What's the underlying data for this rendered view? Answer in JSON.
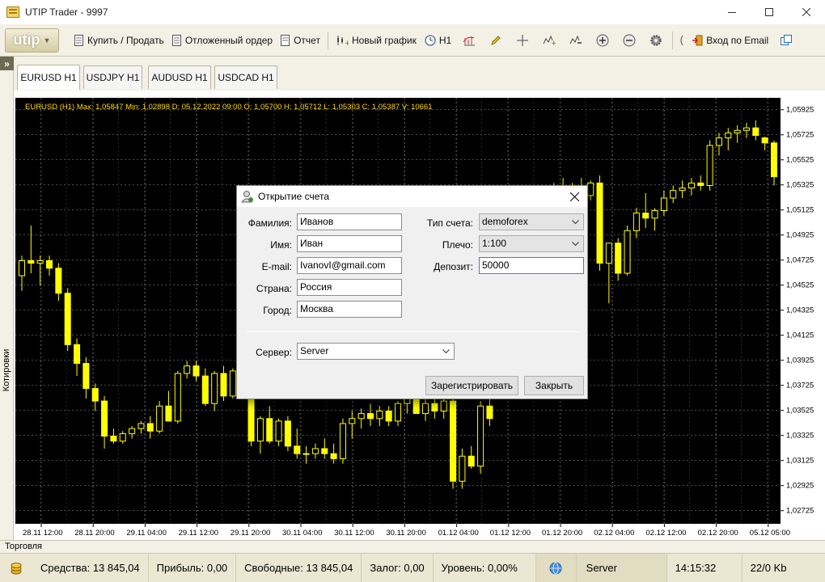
{
  "window": {
    "title": "UTIP Trader - 9997"
  },
  "toolbar": {
    "logo": "utip",
    "buy_sell": "Купить / Продать",
    "pending_order": "Отложенный ордер",
    "report": "Отчет",
    "new_chart": "Новый график",
    "timeframe": "H1",
    "login_email": "Вход по Email"
  },
  "side_panel": {
    "label": "Котировки"
  },
  "tabs": [
    {
      "label": "EURUSD  H1"
    },
    {
      "label": "USDJPY  H1"
    },
    {
      "label": "AUDUSD  H1"
    },
    {
      "label": "USDCAD  H1"
    }
  ],
  "chart_info": "EURUSD (H1)  Max: 1,05847  Min: 1,02898  D: 05.12.2022 09:00  O: 1,05700  H: 1,05712  L: 1,05303  C: 1,05387  V: 10661",
  "chart_data": {
    "type": "candlestick",
    "symbol": "EURUSD",
    "timeframe": "H1",
    "ylim": [
      1.0262,
      1.0602
    ],
    "grid": true,
    "background": "#000000",
    "candle_color": "#ffff00",
    "y_ticks": [
      "1,05925",
      "1,05725",
      "1,05525",
      "1,05325",
      "1,05125",
      "1,04925",
      "1,04725",
      "1,04525",
      "1,04325",
      "1,04125",
      "1,03925",
      "1,03725",
      "1,03525",
      "1,03325",
      "1,03125",
      "1,02925",
      "1,02725"
    ],
    "x_ticks": [
      "28.11 12:00",
      "28.11 20:00",
      "29.11 04:00",
      "29.11 12:00",
      "29.11 20:00",
      "30.11 04:00",
      "30.11 12:00",
      "30.11 20:00",
      "01.12 04:00",
      "01.12 12:00",
      "01.12 20:00",
      "02.12 04:00",
      "02.12 12:00",
      "02.12 20:00",
      "05.12 05:00"
    ],
    "candles": [
      [
        1.046,
        1.0476,
        1.0448,
        1.0472
      ],
      [
        1.0472,
        1.05,
        1.0462,
        1.047
      ],
      [
        1.047,
        1.0476,
        1.0452,
        1.0472
      ],
      [
        1.0472,
        1.0476,
        1.046,
        1.0466
      ],
      [
        1.0466,
        1.047,
        1.044,
        1.0446
      ],
      [
        1.0446,
        1.045,
        1.04,
        1.0405
      ],
      [
        1.0405,
        1.041,
        1.038,
        1.039
      ],
      [
        1.039,
        1.0395,
        1.0362,
        1.037
      ],
      [
        1.037,
        1.0374,
        1.0352,
        1.036
      ],
      [
        1.036,
        1.0364,
        1.0322,
        1.0332
      ],
      [
        1.0332,
        1.0338,
        1.0326,
        1.0328
      ],
      [
        1.0328,
        1.0336,
        1.0326,
        1.0334
      ],
      [
        1.0334,
        1.034,
        1.033,
        1.0338
      ],
      [
        1.0338,
        1.0344,
        1.0334,
        1.0342
      ],
      [
        1.0342,
        1.0348,
        1.033,
        1.0336
      ],
      [
        1.0336,
        1.036,
        1.0334,
        1.0356
      ],
      [
        1.0356,
        1.0368,
        1.0346,
        1.0344
      ],
      [
        1.0344,
        1.0384,
        1.0342,
        1.0382
      ],
      [
        1.0382,
        1.0392,
        1.0378,
        1.0388
      ],
      [
        1.0388,
        1.0392,
        1.0376,
        1.038
      ],
      [
        1.038,
        1.0386,
        1.0356,
        1.0358
      ],
      [
        1.0358,
        1.0384,
        1.0352,
        1.0382
      ],
      [
        1.0382,
        1.0388,
        1.036,
        1.0364
      ],
      [
        1.0364,
        1.0386,
        1.0362,
        1.0384
      ],
      [
        1.0384,
        1.0388,
        1.0364,
        1.0368
      ],
      [
        1.0368,
        1.0372,
        1.0324,
        1.0328
      ],
      [
        1.0328,
        1.0348,
        1.0318,
        1.0346
      ],
      [
        1.0346,
        1.0356,
        1.0326,
        1.0328
      ],
      [
        1.0328,
        1.0346,
        1.0324,
        1.0344
      ],
      [
        1.0344,
        1.0348,
        1.032,
        1.0324
      ],
      [
        1.0324,
        1.0338,
        1.0314,
        1.0318
      ],
      [
        1.0318,
        1.0324,
        1.031,
        1.0318
      ],
      [
        1.0318,
        1.0326,
        1.0314,
        1.0322
      ],
      [
        1.0322,
        1.033,
        1.0314,
        1.0318
      ],
      [
        1.0318,
        1.0326,
        1.031,
        1.0314
      ],
      [
        1.0314,
        1.0346,
        1.031,
        1.0342
      ],
      [
        1.0342,
        1.0352,
        1.033,
        1.0346
      ],
      [
        1.0346,
        1.0354,
        1.0338,
        1.035
      ],
      [
        1.035,
        1.0358,
        1.034,
        1.0346
      ],
      [
        1.0346,
        1.0356,
        1.034,
        1.0352
      ],
      [
        1.0352,
        1.0356,
        1.034,
        1.0344
      ],
      [
        1.0344,
        1.036,
        1.034,
        1.0358
      ],
      [
        1.0358,
        1.037,
        1.035,
        1.0362
      ],
      [
        1.0362,
        1.0374,
        1.0354,
        1.035
      ],
      [
        1.035,
        1.0362,
        1.0344,
        1.0358
      ],
      [
        1.0358,
        1.0366,
        1.0346,
        1.0352
      ],
      [
        1.0352,
        1.0364,
        1.0346,
        1.036
      ],
      [
        1.036,
        1.0364,
        1.029,
        1.0296
      ],
      [
        1.0296,
        1.0322,
        1.029,
        1.0316
      ],
      [
        1.0316,
        1.0324,
        1.0306,
        1.0308
      ],
      [
        1.0308,
        1.036,
        1.0302,
        1.0356
      ],
      [
        1.0356,
        1.0362,
        1.034,
        1.0346
      ],
      [
        1.05,
        1.0508,
        1.0494,
        1.0506
      ],
      [
        1.0506,
        1.0516,
        1.0502,
        1.0514
      ],
      [
        1.0514,
        1.052,
        1.0506,
        1.0516
      ],
      [
        1.0516,
        1.0522,
        1.051,
        1.0512
      ],
      [
        1.0512,
        1.053,
        1.051,
        1.0526
      ],
      [
        1.0526,
        1.0532,
        1.0516,
        1.052
      ],
      [
        1.052,
        1.0534,
        1.0516,
        1.053
      ],
      [
        1.053,
        1.0538,
        1.0522,
        1.0526
      ],
      [
        1.0526,
        1.0534,
        1.052,
        1.0532
      ],
      [
        1.0532,
        1.0538,
        1.0522,
        1.0524
      ],
      [
        1.0524,
        1.0536,
        1.052,
        1.0534
      ],
      [
        1.0534,
        1.054,
        1.0464,
        1.047
      ],
      [
        1.047,
        1.0476,
        1.0438,
        1.0486
      ],
      [
        1.0486,
        1.049,
        1.0456,
        1.0462
      ],
      [
        1.0462,
        1.05,
        1.046,
        1.0496
      ],
      [
        1.0496,
        1.0514,
        1.049,
        1.051
      ],
      [
        1.051,
        1.0526,
        1.0498,
        1.0506
      ],
      [
        1.0506,
        1.0514,
        1.0496,
        1.0512
      ],
      [
        1.0512,
        1.0528,
        1.0508,
        1.0522
      ],
      [
        1.0522,
        1.0532,
        1.0518,
        1.0528
      ],
      [
        1.0528,
        1.0536,
        1.0522,
        1.053
      ],
      [
        1.053,
        1.0538,
        1.0524,
        1.0534
      ],
      [
        1.0534,
        1.054,
        1.0528,
        1.0532
      ],
      [
        1.0532,
        1.0568,
        1.0528,
        1.0564
      ],
      [
        1.0564,
        1.0574,
        1.0556,
        1.057
      ],
      [
        1.057,
        1.0578,
        1.056,
        1.0574
      ],
      [
        1.0574,
        1.058,
        1.0566,
        1.0576
      ],
      [
        1.0576,
        1.0582,
        1.057,
        1.0578
      ],
      [
        1.0578,
        1.0584,
        1.0568,
        1.0572
      ],
      [
        1.057,
        1.0571,
        1.056,
        1.0566
      ],
      [
        1.0566,
        1.0568,
        1.0532,
        1.0539
      ]
    ]
  },
  "dialog": {
    "title": "Открытие счета",
    "labels": {
      "last_name": "Фамилия:",
      "first_name": "Имя:",
      "email": "E-mail:",
      "country": "Страна:",
      "city": "Город:",
      "account_type": "Тип счета:",
      "leverage": "Плечо:",
      "deposit": "Депозит:",
      "server": "Сервер:"
    },
    "values": {
      "last_name": "Иванов",
      "first_name": "Иван",
      "email": "IvanovI@gmail.com",
      "country": "Россия",
      "city": "Москва",
      "account_type": "demoforex",
      "leverage": "1:100",
      "deposit": "50000",
      "server": "Server"
    },
    "buttons": {
      "register": "Зарегистрировать",
      "close": "Закрыть"
    }
  },
  "bottom_panel": {
    "label": "Торговля"
  },
  "statusbar": {
    "equity": "Средства: 13 845,04",
    "profit": "Прибыль: 0,00",
    "free": "Свободные: 13 845,04",
    "margin": "Залог: 0,00",
    "level": "Уровень: 0,00%",
    "server": "Server",
    "time": "14:15:32",
    "traffic": "22/0 Kb"
  }
}
